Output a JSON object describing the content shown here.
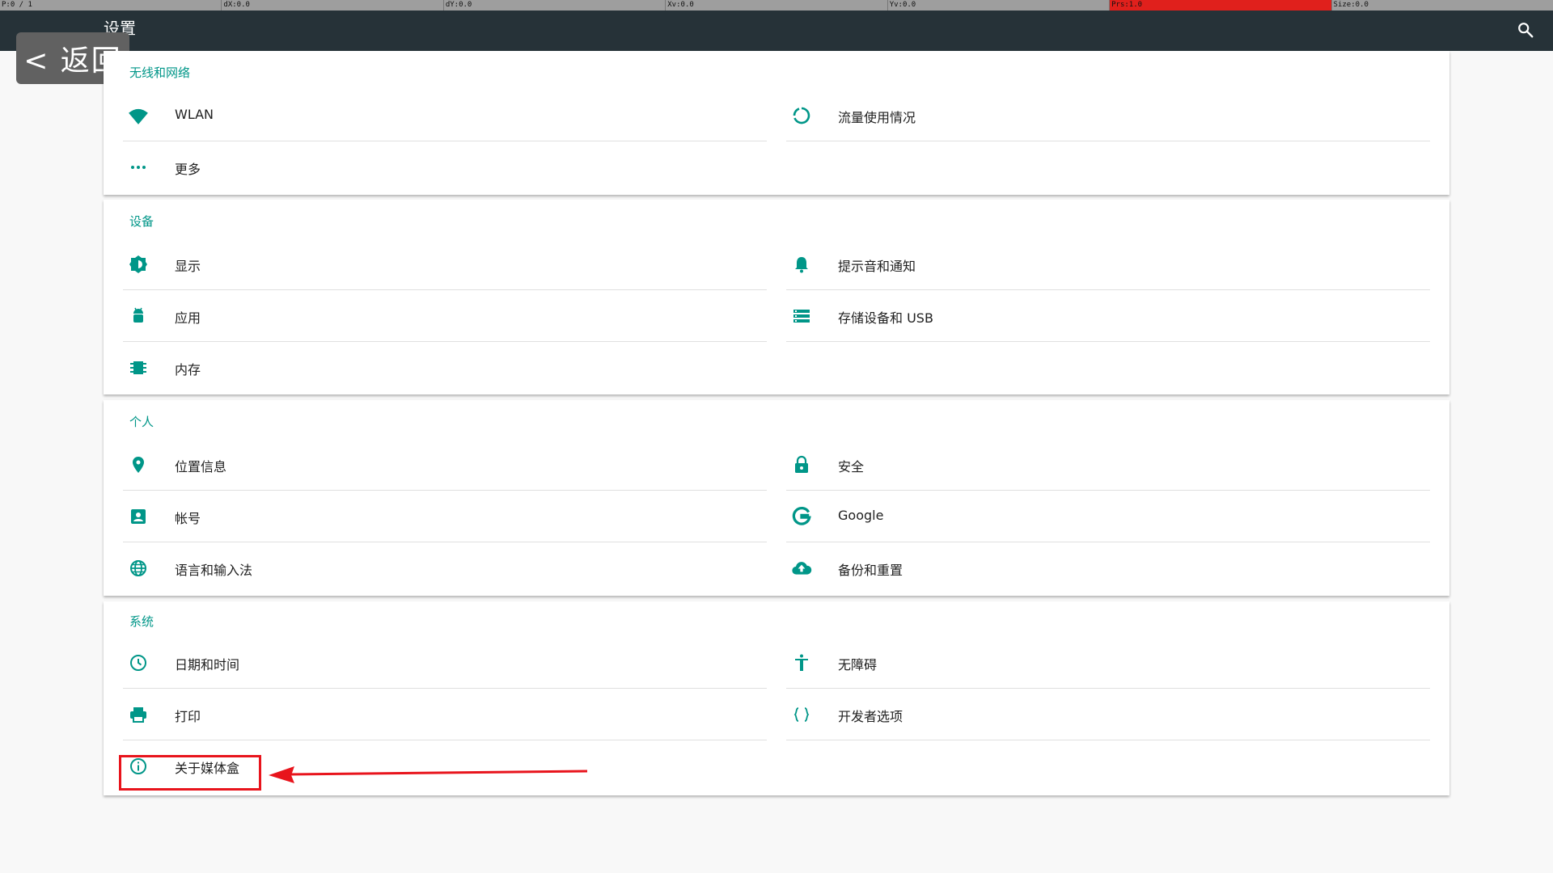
{
  "debug": {
    "pointer": "P:0 / 1",
    "dx": "dX:0.0",
    "dy": "dY:0.0",
    "xv": "Xv:0.0",
    "yv": "Yv:0.0",
    "prs": "Prs:1.0",
    "size": "Size:0.0"
  },
  "action_bar": {
    "title": "设置",
    "search_icon": "search-icon"
  },
  "back_overlay": {
    "label": "< 返回"
  },
  "accent_color": "#009688",
  "sections": [
    {
      "title": "无线和网络",
      "items": [
        {
          "label": "WLAN",
          "icon": "wifi-icon"
        },
        {
          "label": "流量使用情况",
          "icon": "data-usage-icon"
        },
        {
          "label": "更多",
          "icon": "more-icon"
        }
      ]
    },
    {
      "title": "设备",
      "items": [
        {
          "label": "显示",
          "icon": "brightness-icon"
        },
        {
          "label": "提示音和通知",
          "icon": "bell-icon"
        },
        {
          "label": "应用",
          "icon": "android-icon"
        },
        {
          "label": "存储设备和 USB",
          "icon": "storage-icon"
        },
        {
          "label": "内存",
          "icon": "memory-icon"
        }
      ]
    },
    {
      "title": "个人",
      "items": [
        {
          "label": "位置信息",
          "icon": "location-icon"
        },
        {
          "label": "安全",
          "icon": "lock-icon"
        },
        {
          "label": "帐号",
          "icon": "account-icon"
        },
        {
          "label": "Google",
          "icon": "google-icon"
        },
        {
          "label": "语言和输入法",
          "icon": "globe-icon"
        },
        {
          "label": "备份和重置",
          "icon": "cloud-upload-icon"
        }
      ]
    },
    {
      "title": "系统",
      "items": [
        {
          "label": "日期和时间",
          "icon": "clock-icon"
        },
        {
          "label": "无障碍",
          "icon": "accessibility-icon"
        },
        {
          "label": "打印",
          "icon": "print-icon"
        },
        {
          "label": "开发者选项",
          "icon": "code-braces-icon"
        },
        {
          "label": "关于媒体盒",
          "icon": "info-icon"
        }
      ]
    }
  ]
}
